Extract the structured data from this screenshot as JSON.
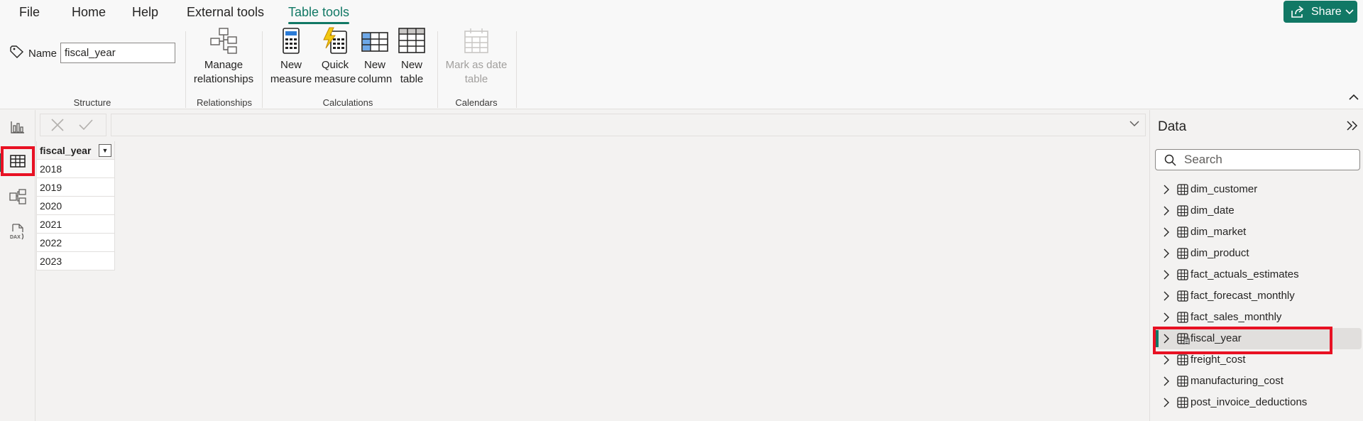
{
  "menu": {
    "items": [
      "File",
      "Home",
      "Help",
      "External tools",
      "Table tools"
    ],
    "active": "Table tools",
    "share_label": "Share"
  },
  "ribbon": {
    "structure": {
      "name_label": "Name",
      "name_value": "fiscal_year",
      "group_label": "Structure"
    },
    "relationships": {
      "manage_label_1": "Manage",
      "manage_label_2": "relationships",
      "group_label": "Relationships"
    },
    "calculations": {
      "new_measure_1": "New",
      "new_measure_2": "measure",
      "quick_measure_1": "Quick",
      "quick_measure_2": "measure",
      "new_column_1": "New",
      "new_column_2": "column",
      "new_table_1": "New",
      "new_table_2": "table",
      "group_label": "Calculations"
    },
    "calendars": {
      "mark_date_1": "Mark as date",
      "mark_date_2": "table",
      "group_label": "Calendars"
    }
  },
  "rail": {
    "icons": [
      "report-view-icon",
      "table-view-icon",
      "model-view-icon",
      "dax-query-icon"
    ],
    "active": "table-view-icon"
  },
  "table": {
    "column": "fiscal_year",
    "rows": [
      "2018",
      "2019",
      "2020",
      "2021",
      "2022",
      "2023"
    ]
  },
  "data_pane": {
    "title": "Data",
    "search_placeholder": "Search",
    "items": [
      "dim_customer",
      "dim_date",
      "dim_market",
      "dim_product",
      "fact_actuals_estimates",
      "fact_forecast_monthly",
      "fact_sales_monthly",
      "fiscal_year",
      "freight_cost",
      "manufacturing_cost",
      "post_invoice_deductions"
    ],
    "selected": "fiscal_year"
  },
  "colors": {
    "accent": "#117865",
    "highlight": "#e81123"
  }
}
